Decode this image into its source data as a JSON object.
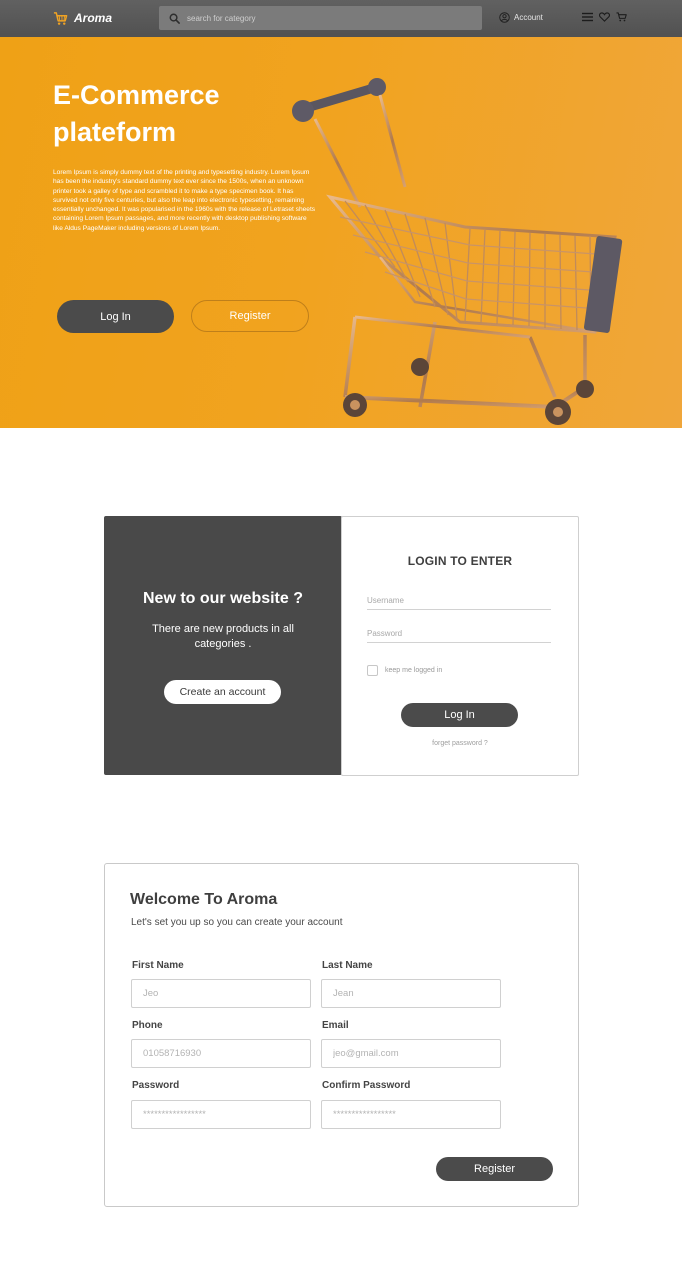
{
  "nav": {
    "logo_text": "Aroma",
    "search_placeholder": "search for category",
    "account_label": "Account"
  },
  "hero": {
    "title": "E-Commerce plateform",
    "description": "Lorem Ipsum is simply dummy text of the printing and typesetting industry. Lorem Ipsum has been the industry's standard dummy text ever since the 1500s, when an unknown printer took a galley of type and scrambled it to make a type specimen book. It has survived not only five centuries, but also the leap into electronic typesetting, remaining essentially unchanged. It was popularised in the 1960s with the release of Letraset sheets containing Lorem Ipsum passages, and more recently with desktop publishing software like Aldus PageMaker including versions of Lorem Ipsum.",
    "login_label": "Log In",
    "register_label": "Register"
  },
  "welcome_panel": {
    "title": "New to our website ?",
    "subtitle": "There are new products in all categories .",
    "create_account_label": "Create an account"
  },
  "login": {
    "title": "LOGIN TO ENTER",
    "username_placeholder": "Username",
    "password_placeholder": "Password",
    "keep_logged_in": "keep me logged in",
    "login_label": "Log In",
    "forget_password": "forget password ?"
  },
  "register": {
    "title": "Welcome To Aroma",
    "subtitle": "Let's set you up so you can create your account",
    "first_name_label": "First Name",
    "first_name_placeholder": "Jeo",
    "last_name_label": "Last Name",
    "last_name_placeholder": "Jean",
    "phone_label": "Phone",
    "phone_placeholder": "01058716930",
    "email_label": "Email",
    "email_placeholder": "jeo@gmail.com",
    "password_label": "Password",
    "password_placeholder": "*****************",
    "confirm_password_label": "Confirm Password",
    "confirm_password_placeholder": "*****************",
    "register_label": "Register"
  },
  "colors": {
    "accent_orange": "#f1a31f",
    "dark_gray": "#4b4b4b",
    "nav_gray": "#5a5a5a"
  },
  "icons": [
    "cart-logo-icon",
    "search-icon",
    "account-icon",
    "menu-icon",
    "heart-icon",
    "cart-icon"
  ]
}
